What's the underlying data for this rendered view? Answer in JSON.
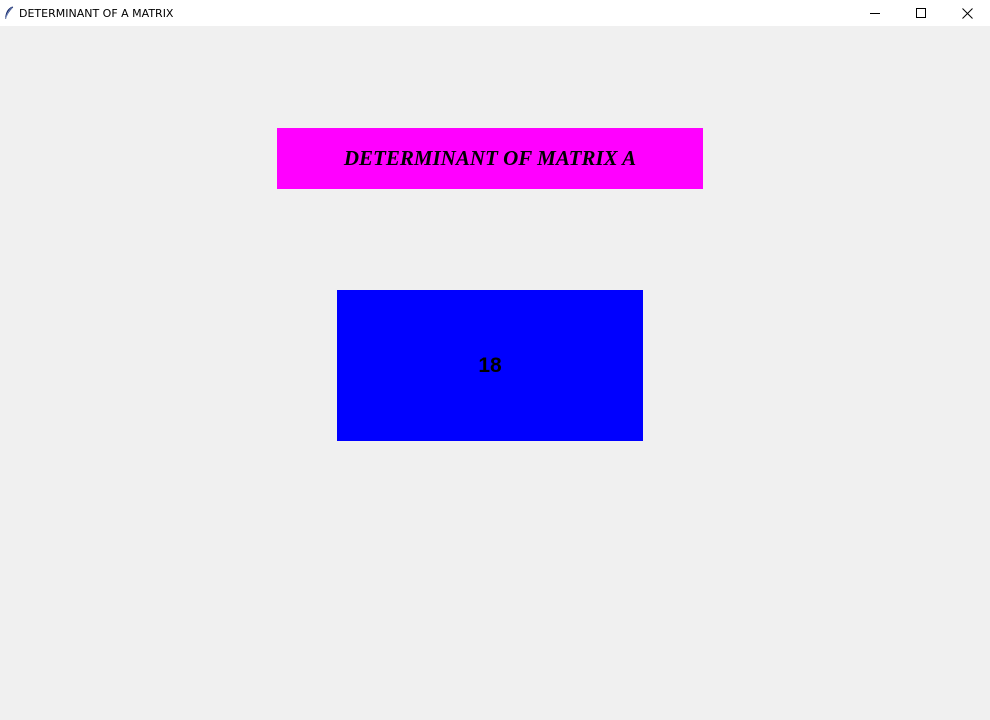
{
  "window": {
    "title": "DETERMINANT OF A MATRIX",
    "icon": "feather-icon"
  },
  "titlebar_controls": {
    "minimize_icon": "minimize-icon",
    "maximize_icon": "maximize-icon",
    "close_icon": "close-icon"
  },
  "heading": {
    "text": "DETERMINANT OF MATRIX A",
    "background_color": "#ff00ff"
  },
  "result": {
    "value": "18",
    "background_color": "#0000ff"
  },
  "colors": {
    "window_background": "#f0f0f0",
    "titlebar_background": "#ffffff"
  }
}
